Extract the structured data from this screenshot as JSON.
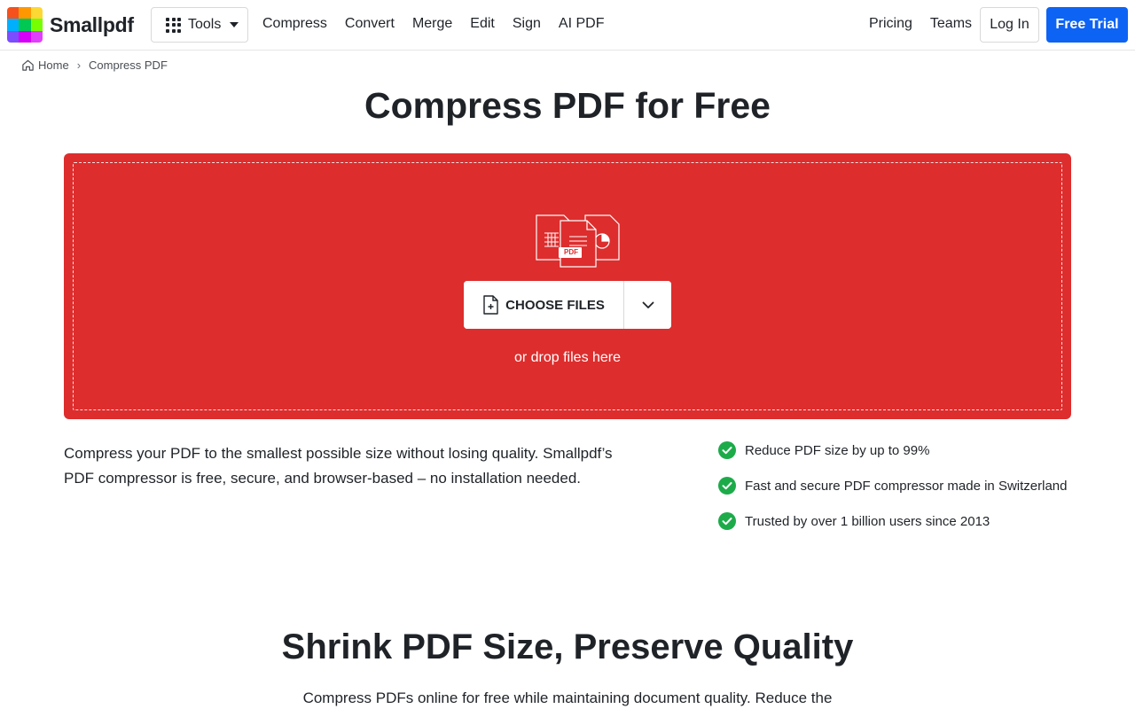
{
  "brand": {
    "name": "Smallpdf",
    "logo_colors": [
      "#f4511e",
      "#ff9800",
      "#fdd835",
      "#00b0ff",
      "#00c853",
      "#76ff03",
      "#7c4dff",
      "#d500f9",
      "#e040fb"
    ]
  },
  "header": {
    "tools_label": "Tools",
    "nav": [
      "Compress",
      "Convert",
      "Merge",
      "Edit",
      "Sign",
      "AI PDF"
    ],
    "right_nav": [
      "Pricing",
      "Teams"
    ],
    "login_label": "Log In",
    "trial_label": "Free Trial",
    "accent_color": "#0d63f4"
  },
  "breadcrumb": {
    "home": "Home",
    "current": "Compress PDF"
  },
  "main": {
    "title": "Compress PDF for Free",
    "dropzone": {
      "color": "#dd2d2d",
      "file_badge": "PDF",
      "choose_label": "CHOOSE FILES",
      "drop_text": "or drop files here"
    },
    "description": "Compress your PDF to the smallest possible size without losing quality. Smallpdf’s PDF compressor is free, secure, and browser-based – no installation needed.",
    "features": [
      "Reduce PDF size by up to 99%",
      "Fast and secure PDF compressor made in Switzerland",
      "Trusted by over 1 billion users since 2013"
    ],
    "check_color": "#1dab4a"
  },
  "section2": {
    "title": "Shrink PDF Size, Preserve Quality",
    "desc": "Compress PDFs online for free while maintaining document quality. Reduce the"
  }
}
